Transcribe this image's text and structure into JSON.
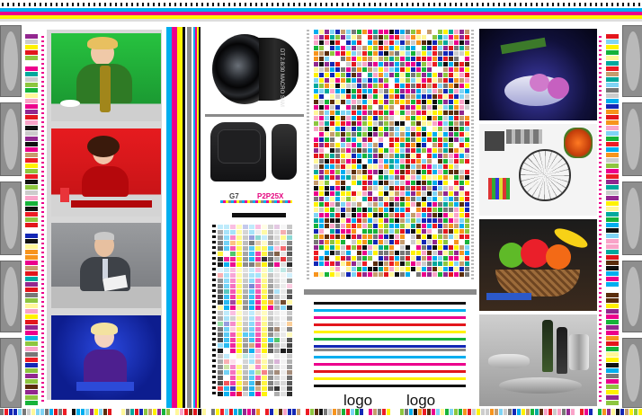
{
  "colors": {
    "cyan": "#00aeef",
    "magenta": "#ec008c",
    "yellow": "#fff200",
    "black": "#111111",
    "green_bg": "#16b33a",
    "red_bg": "#e3161c",
    "gray_bg": "#7f8287",
    "blue_bg": "#1327b5"
  },
  "portraits": [
    {
      "name": "portrait-green-backdrop",
      "bg": "#22a83a"
    },
    {
      "name": "portrait-red-backdrop",
      "bg": "#d8191c"
    },
    {
      "name": "portrait-gray-backdrop",
      "bg": "#8b8d90"
    },
    {
      "name": "portrait-blue-backdrop",
      "bg": "#1a2fb8"
    }
  ],
  "products": {
    "lens_label": "DT 2.8/30 MACRO SAM",
    "g7_label": "G7",
    "p2p_label": "P2P25X"
  },
  "logos": [
    "logo",
    "logo"
  ]
}
